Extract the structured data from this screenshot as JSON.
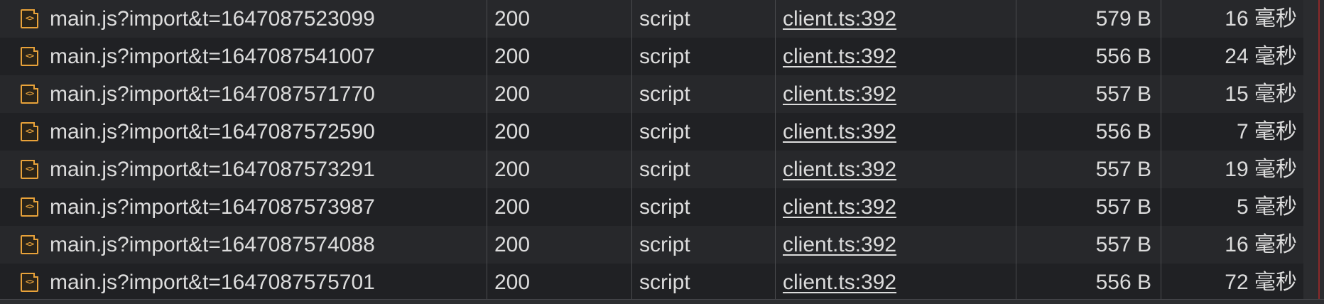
{
  "colors": {
    "background": "#202124",
    "row_alt": "#27282b",
    "text": "#dcdcdc",
    "script_icon": "#e8a23a",
    "grid_line": "#4a4b4e"
  },
  "icon_glyph": "<>",
  "rows": [
    {
      "icon": "script-file-icon",
      "name": "main.js?import&t=1647087523099",
      "status": "200",
      "type": "script",
      "initiator": "client.ts:392",
      "size": "579 B",
      "time": "16 毫秒"
    },
    {
      "icon": "script-file-icon",
      "name": "main.js?import&t=1647087541007",
      "status": "200",
      "type": "script",
      "initiator": "client.ts:392",
      "size": "556 B",
      "time": "24 毫秒"
    },
    {
      "icon": "script-file-icon",
      "name": "main.js?import&t=1647087571770",
      "status": "200",
      "type": "script",
      "initiator": "client.ts:392",
      "size": "557 B",
      "time": "15 毫秒"
    },
    {
      "icon": "script-file-icon",
      "name": "main.js?import&t=1647087572590",
      "status": "200",
      "type": "script",
      "initiator": "client.ts:392",
      "size": "556 B",
      "time": "7 毫秒"
    },
    {
      "icon": "script-file-icon",
      "name": "main.js?import&t=1647087573291",
      "status": "200",
      "type": "script",
      "initiator": "client.ts:392",
      "size": "557 B",
      "time": "19 毫秒"
    },
    {
      "icon": "script-file-icon",
      "name": "main.js?import&t=1647087573987",
      "status": "200",
      "type": "script",
      "initiator": "client.ts:392",
      "size": "557 B",
      "time": "5 毫秒"
    },
    {
      "icon": "script-file-icon",
      "name": "main.js?import&t=1647087574088",
      "status": "200",
      "type": "script",
      "initiator": "client.ts:392",
      "size": "557 B",
      "time": "16 毫秒"
    },
    {
      "icon": "script-file-icon",
      "name": "main.js?import&t=1647087575701",
      "status": "200",
      "type": "script",
      "initiator": "client.ts:392",
      "size": "556 B",
      "time": "72 毫秒"
    }
  ]
}
